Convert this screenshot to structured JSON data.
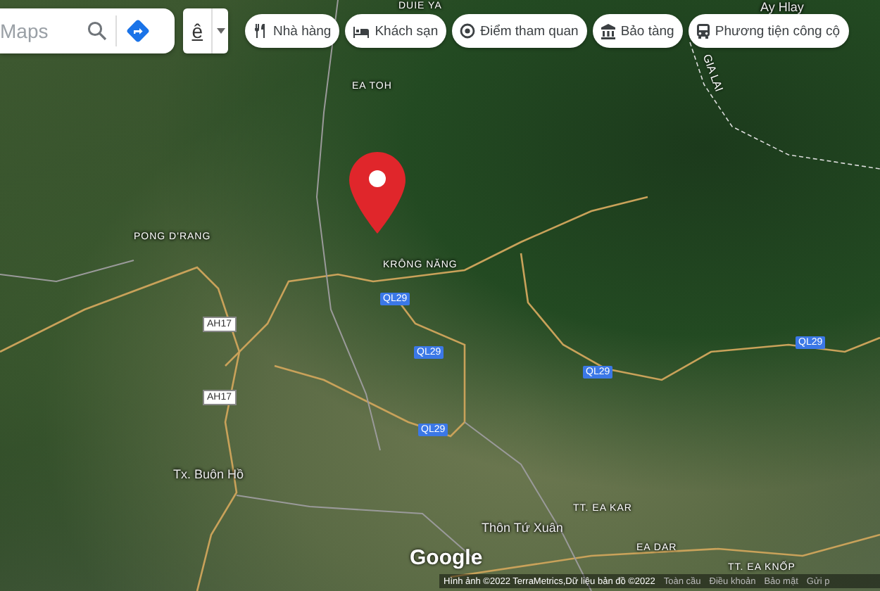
{
  "search": {
    "placeholder": "Maps"
  },
  "input_method": {
    "label": "ê"
  },
  "chips": [
    {
      "kind": "restaurant",
      "label": "Nhà hàng"
    },
    {
      "kind": "hotel",
      "label": "Khách sạn"
    },
    {
      "kind": "attraction",
      "label": "Điểm tham quan"
    },
    {
      "kind": "museum",
      "label": "Bảo tàng"
    },
    {
      "kind": "transit",
      "label": "Phương tiện công cộ"
    }
  ],
  "map": {
    "labels": [
      {
        "kind": "place",
        "text": "DUIE YA"
      },
      {
        "kind": "town",
        "text": "Ay Hlay"
      },
      {
        "kind": "region",
        "text": "GIA LAI"
      },
      {
        "kind": "place",
        "text": "EA TOH"
      },
      {
        "kind": "place",
        "text": "PONG D'RANG"
      },
      {
        "kind": "place",
        "text": "KRÔNG NĂNG"
      },
      {
        "kind": "road",
        "text": "QL29"
      },
      {
        "kind": "highway",
        "text": "AH17"
      },
      {
        "kind": "road",
        "text": "QL29"
      },
      {
        "kind": "highway",
        "text": "AH17"
      },
      {
        "kind": "road",
        "text": "QL29"
      },
      {
        "kind": "road",
        "text": "QL29"
      },
      {
        "kind": "road",
        "text": "QL29"
      },
      {
        "kind": "town",
        "text": "Tx. Buôn Hồ"
      },
      {
        "kind": "town",
        "text": "Thôn Tứ Xuân"
      },
      {
        "kind": "place",
        "text": "TT. EA KAR"
      },
      {
        "kind": "place",
        "text": "EA DAR"
      },
      {
        "kind": "place",
        "text": "TT. EA KNỐP"
      }
    ]
  },
  "logo": "Google",
  "footer": {
    "attribution": "Hình ảnh ©2022 TerraMetrics,Dữ liệu bản đồ ©2022",
    "links": [
      "Toàn cầu",
      "Điều khoản",
      "Bảo mật",
      "Gửi p"
    ]
  }
}
